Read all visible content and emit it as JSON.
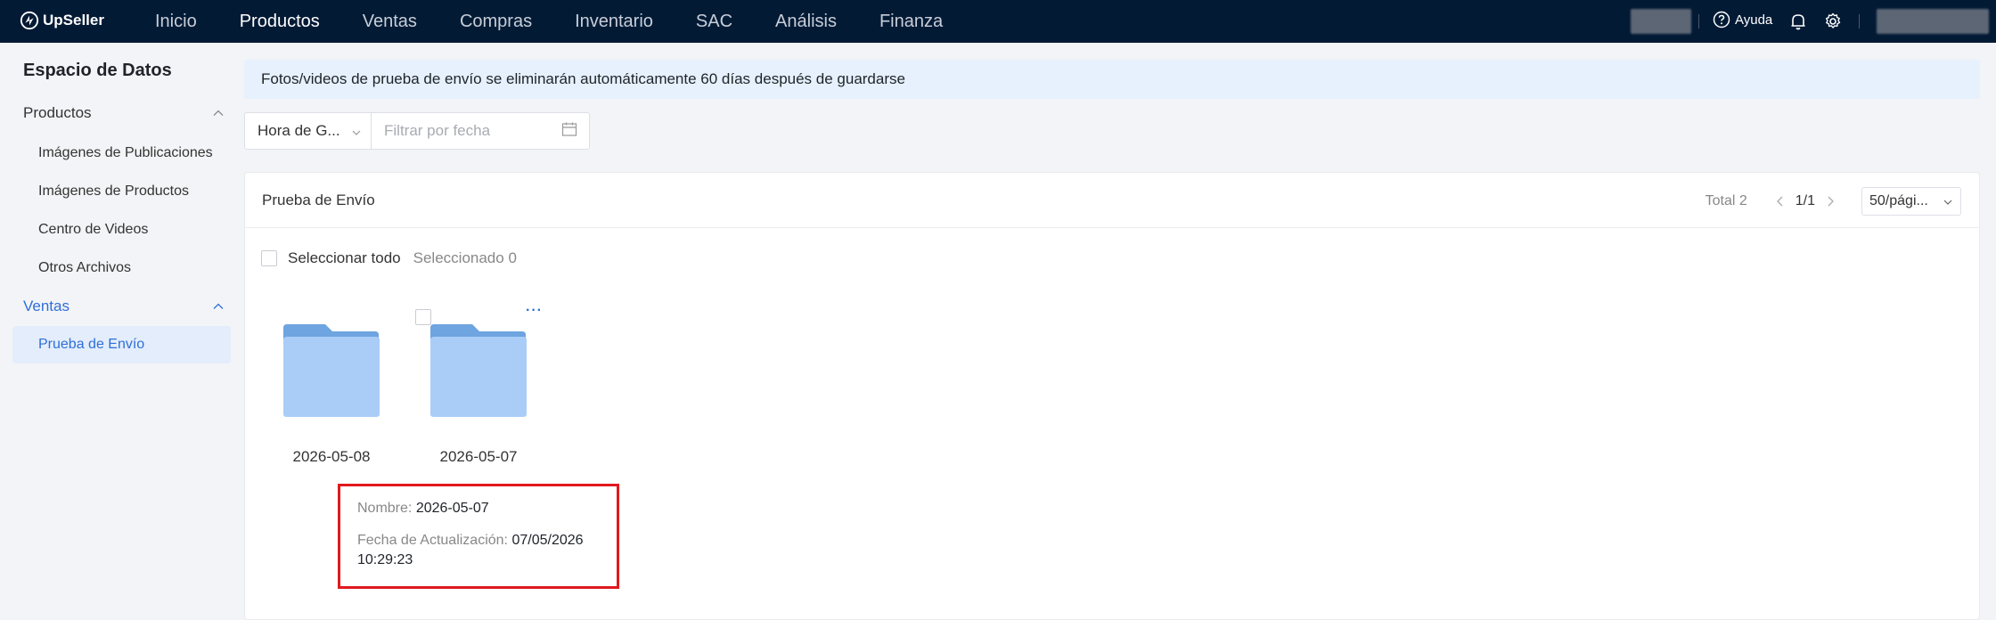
{
  "app": {
    "brand": "UpSeller"
  },
  "nav": {
    "items": [
      {
        "label": "Inicio",
        "active": false
      },
      {
        "label": "Productos",
        "active": true
      },
      {
        "label": "Ventas",
        "active": false
      },
      {
        "label": "Compras",
        "active": false
      },
      {
        "label": "Inventario",
        "active": false
      },
      {
        "label": "SAC",
        "active": false
      },
      {
        "label": "Análisis",
        "active": false
      },
      {
        "label": "Finanza",
        "active": false
      }
    ],
    "help_label": "Ayuda"
  },
  "sidebar": {
    "title": "Espacio de Datos",
    "groups": [
      {
        "label": "Productos",
        "items": [
          {
            "label": "Imágenes de Publicaciones"
          },
          {
            "label": "Imágenes de Productos"
          },
          {
            "label": "Centro de Videos"
          },
          {
            "label": "Otros Archivos"
          }
        ]
      },
      {
        "label": "Ventas",
        "items": [
          {
            "label": "Prueba de Envío",
            "active": true
          }
        ]
      }
    ]
  },
  "notice": "Fotos/videos de prueba de envío se eliminarán automáticamente 60 días después de guardarse",
  "filter": {
    "select_value": "Hora de G...",
    "date_placeholder": "Filtrar por fecha"
  },
  "panel": {
    "title": "Prueba de Envío",
    "total": "Total 2",
    "page": "1/1",
    "page_size": "50/pági...",
    "select_all": "Seleccionar todo",
    "selected": "Seleccionado 0",
    "folders": [
      {
        "name": "2026-05-08"
      },
      {
        "name": "2026-05-07"
      }
    ],
    "more": "···"
  },
  "tooltip": {
    "name_key": "Nombre:",
    "name_value": "2026-05-07",
    "date_key": "Fecha de Actualización:",
    "date_value_1": "07/05/2026",
    "date_value_2": "10:29:23"
  },
  "colors": {
    "topbar": "#031a35",
    "accent": "#2f6fd8",
    "folder": "#a9cdf7",
    "highlight": "#e0191f"
  }
}
